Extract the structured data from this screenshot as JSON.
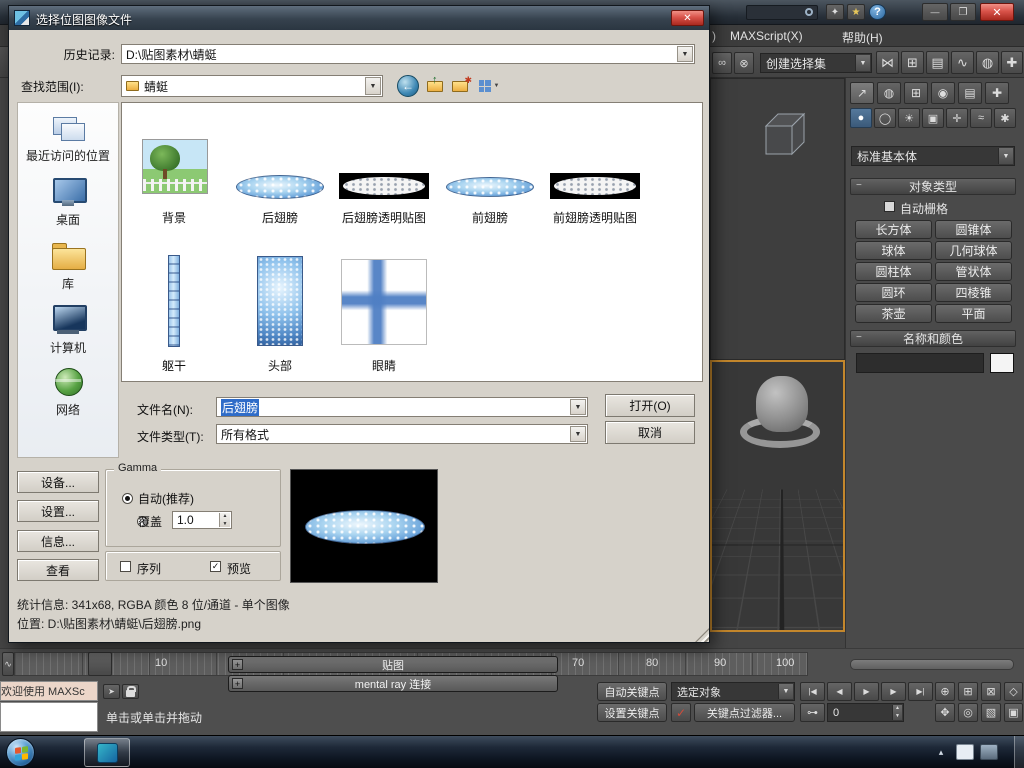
{
  "glyphs": {
    "dropdown": "▼",
    "spin_up": "▲",
    "spin_down": "▼",
    "close": "✕",
    "win_min": "—",
    "win_max": "❐",
    "help": "?",
    "star": "★",
    "spark": "✦",
    "check": "✓",
    "plus": "+",
    "minus": "−",
    "back": "←",
    "up": "↑",
    "new": "✱",
    "cursor": "➤",
    "tray_up": "▴",
    "key_mode": "⊶",
    "toolbar": [
      "∞",
      "⊗",
      "⋈",
      "⊞",
      "▤",
      "∿",
      "◍",
      "✚"
    ],
    "tabs": [
      "↗",
      "◍",
      "⊞",
      "◉",
      "▤",
      "✚"
    ],
    "subtabs": [
      "●",
      "◯",
      "☀",
      "▣",
      "✛",
      "≈",
      "✱"
    ],
    "playback": [
      "|◀",
      "◀",
      "▶",
      "▶",
      "▶|"
    ],
    "nav1": [
      "⊕",
      "⊞",
      "⊠",
      "◇"
    ],
    "nav2": [
      "✥",
      "◎",
      "▧",
      "▣"
    ]
  },
  "dialog": {
    "title": "选择位图图像文件",
    "history": {
      "label": "历史记录:",
      "value": "D:\\贴图素材\\蜻蜓"
    },
    "look_in": {
      "label": "查找范围(I):",
      "value": "蜻蜓"
    },
    "places": [
      {
        "label": "最近访问的位置"
      },
      {
        "label": "桌面"
      },
      {
        "label": "库"
      },
      {
        "label": "计算机"
      },
      {
        "label": "网络"
      }
    ],
    "files": [
      {
        "name": "背景"
      },
      {
        "name": "后翅膀"
      },
      {
        "name": "后翅膀透明贴图"
      },
      {
        "name": "前翅膀"
      },
      {
        "name": "前翅膀透明贴图"
      },
      {
        "name": "躯干"
      },
      {
        "name": "头部"
      },
      {
        "name": "眼睛"
      }
    ],
    "filename": {
      "label": "文件名(N):",
      "value": "后翅膀"
    },
    "filetype": {
      "label": "文件类型(T):",
      "value": "所有格式"
    },
    "buttons": {
      "open": "打开(O)",
      "cancel": "取消",
      "devices": "设备...",
      "setup": "设置...",
      "info": "信息...",
      "view": "查看"
    },
    "gamma": {
      "title": "Gamma",
      "auto": "自动(推荐)",
      "override": "覆盖",
      "override_value": "1.0"
    },
    "options": {
      "sequence": "序列",
      "preview": "预览"
    },
    "stats": "统计信息: 341x68, RGBA 颜色 8 位/通道 - 单个图像",
    "location": "位置: D:\\贴图素材\\蜻蜓\\后翅膀.png"
  },
  "max": {
    "menubar": {
      "fragment": ")",
      "maxscript": "MAXScript(X)",
      "help": "帮助(H)"
    },
    "toolbar": {
      "selection_set": "创建选择集"
    },
    "panel": {
      "dropdown": "标准基本体",
      "rollout_object_type": "对象类型",
      "autogrid": "自动栅格",
      "buttons": [
        "长方体",
        "圆锥体",
        "球体",
        "几何球体",
        "圆柱体",
        "管状体",
        "圆环",
        "四棱锥",
        "茶壶",
        "平面"
      ],
      "rollout_name_color": "名称和颜色"
    },
    "materials": {
      "rollout1": "贴图",
      "rollout2": "mental ray 连接"
    },
    "timeline": {
      "ticks": [
        "10",
        "70",
        "80",
        "90",
        "100"
      ]
    },
    "status": {
      "listener": "欢迎使用 MAXSc",
      "prompt": "单击或单击并拖动",
      "auto_key": "自动关键点",
      "set_key": "设置关键点",
      "selection_combo": "选定对象",
      "key_filters": "关键点过滤器...",
      "frame": "0"
    }
  }
}
